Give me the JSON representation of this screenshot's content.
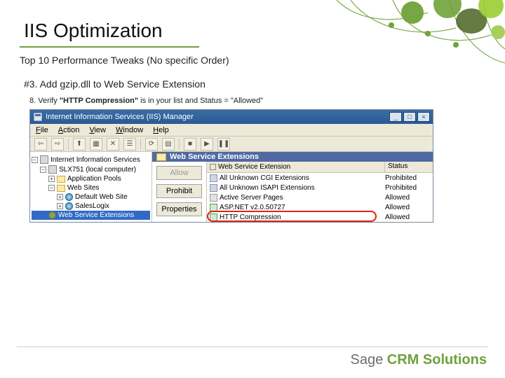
{
  "slide": {
    "title": "IIS Optimization",
    "subtitle": "Top 10 Performance Tweaks (No specific Order)",
    "step": "#3.  Add gzip.dll to Web Service Extension"
  },
  "screenshot": {
    "caption_prefix": "8.  Verify ",
    "caption_quoted": "\"HTTP Compression\"",
    "caption_suffix": " is in your list and Status = \"Allowed\"",
    "window_title": "Internet Information Services (IIS) Manager",
    "menu": {
      "file": "File",
      "action": "Action",
      "view": "View",
      "window": "Window",
      "help": "Help"
    },
    "tree": {
      "root": "Internet Information Services",
      "server": "SLX751 (local computer)",
      "app_pools": "Application Pools",
      "web_sites": "Web Sites",
      "default_site": "Default Web Site",
      "saleslogix": "SalesLogix",
      "wse": "Web Service Extensions"
    },
    "right": {
      "header": "Web Service Extensions",
      "buttons": {
        "allow": "Allow",
        "prohibit": "Prohibit",
        "properties": "Properties"
      },
      "columns": {
        "name": "Web Service Extension",
        "status": "Status"
      },
      "rows": [
        {
          "name": "All Unknown CGI Extensions",
          "status": "Prohibited",
          "icon": "ic-unk"
        },
        {
          "name": "All Unknown ISAPI Extensions",
          "status": "Prohibited",
          "icon": "ic-unk"
        },
        {
          "name": "Active Server Pages",
          "status": "Allowed",
          "icon": "ic-asp"
        },
        {
          "name": "ASP.NET v2.0.50727",
          "status": "Allowed",
          "icon": "ic-net"
        },
        {
          "name": "HTTP Compression",
          "status": "Allowed",
          "icon": "ic-http",
          "highlight": true
        }
      ]
    }
  },
  "brand": {
    "sage": "Sage ",
    "crm": "CRM Solutions"
  }
}
